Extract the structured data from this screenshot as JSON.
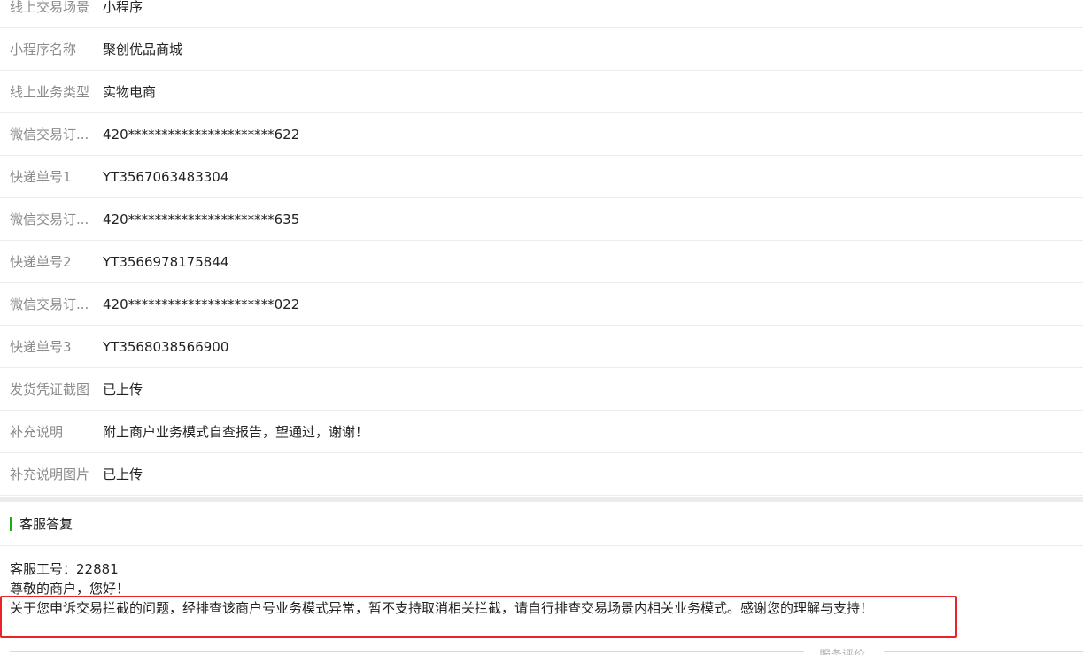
{
  "details": [
    {
      "label": "线上交易场景",
      "value": "小程序"
    },
    {
      "label": "小程序名称",
      "value": "聚创优品商城"
    },
    {
      "label": "线上业务类型",
      "value": "实物电商"
    },
    {
      "label": "微信交易订...",
      "value": "420**********************622"
    },
    {
      "label": "快递单号1",
      "value": "YT3567063483304"
    },
    {
      "label": "微信交易订...",
      "value": "420**********************635"
    },
    {
      "label": "快递单号2",
      "value": "YT3566978175844"
    },
    {
      "label": "微信交易订...",
      "value": "420**********************022"
    },
    {
      "label": "快递单号3",
      "value": "YT3568038566900"
    },
    {
      "label": "发货凭证截图",
      "value": "已上传"
    },
    {
      "label": "补充说明",
      "value": "附上商户业务模式自查报告，望通过，谢谢！"
    },
    {
      "label": "补充说明图片",
      "value": "已上传"
    }
  ],
  "reply": {
    "title": "客服答复",
    "agent_id_line": "客服工号：22881",
    "greeting": "尊敬的商户，您好！",
    "message": "关于您申诉交易拦截的问题，经排查该商户号业务模式异常，暂不支持取消相关拦截，请自行排查交易场景内相关业务模式。感谢您的理解与支持！"
  },
  "footer": {
    "service_rating_label": "服务评价"
  },
  "colors": {
    "accent_green": "#1aad19",
    "highlight_red": "#e8232a",
    "label_gray": "#8a8a8a"
  }
}
